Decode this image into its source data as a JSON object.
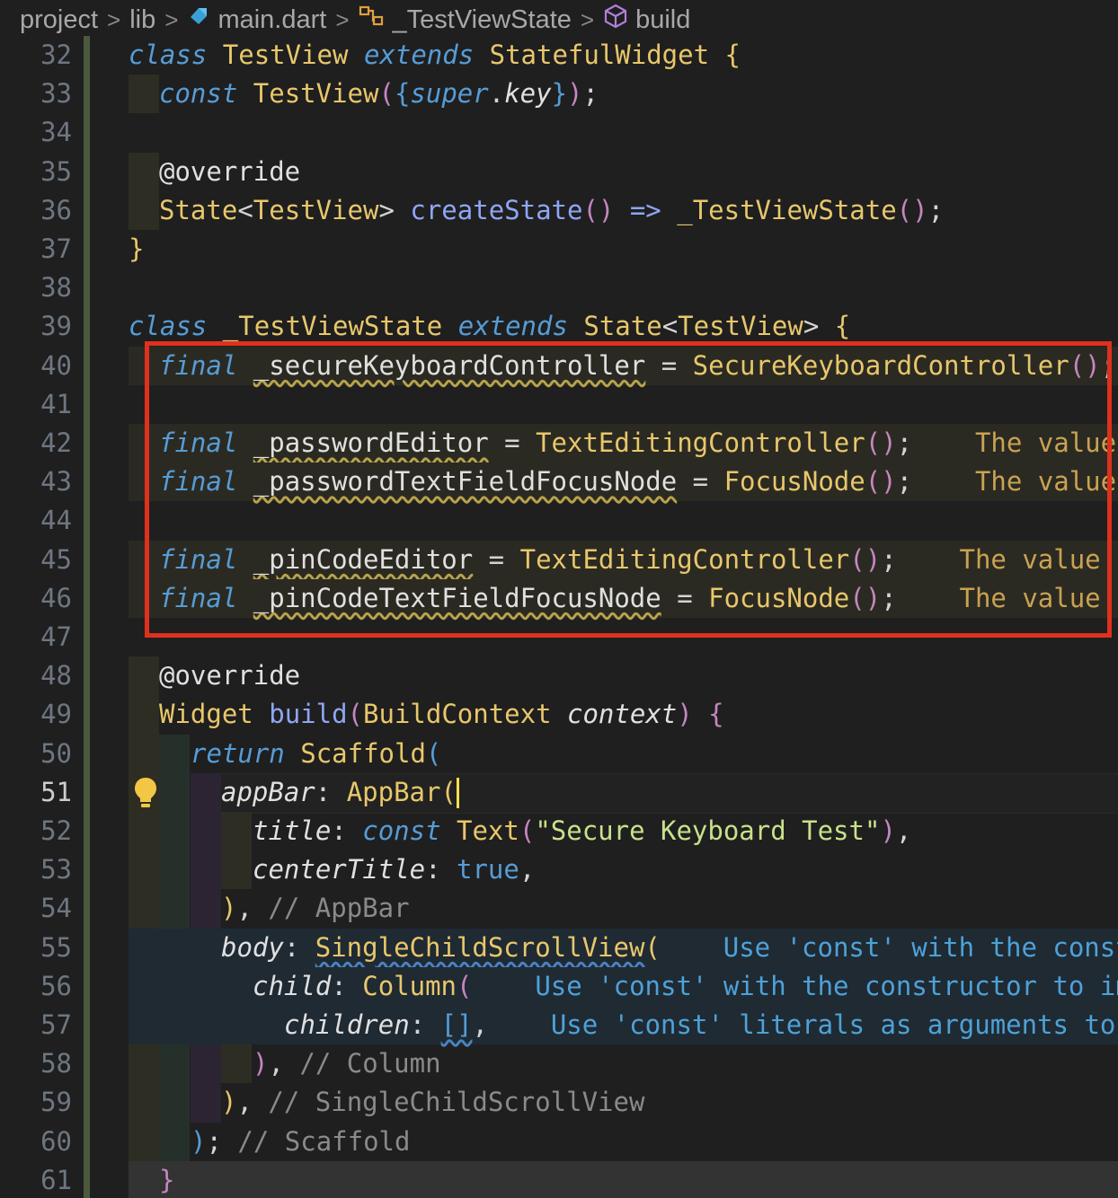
{
  "breadcrumb": {
    "items": [
      "project",
      "lib",
      "main.dart",
      "_TestViewState",
      "build"
    ],
    "separator": ">"
  },
  "editor": {
    "active_line": 51,
    "lines": [
      {
        "n": "32"
      },
      {
        "n": "33"
      },
      {
        "n": "34"
      },
      {
        "n": "35"
      },
      {
        "n": "36"
      },
      {
        "n": "37"
      },
      {
        "n": "38"
      },
      {
        "n": "39"
      },
      {
        "n": "40"
      },
      {
        "n": "41"
      },
      {
        "n": "42"
      },
      {
        "n": "43"
      },
      {
        "n": "44"
      },
      {
        "n": "45"
      },
      {
        "n": "46"
      },
      {
        "n": "47"
      },
      {
        "n": "48"
      },
      {
        "n": "49"
      },
      {
        "n": "50"
      },
      {
        "n": "51"
      },
      {
        "n": "52"
      },
      {
        "n": "53"
      },
      {
        "n": "54"
      },
      {
        "n": "55"
      },
      {
        "n": "56"
      },
      {
        "n": "57"
      },
      {
        "n": "58"
      },
      {
        "n": "59"
      },
      {
        "n": "60"
      },
      {
        "n": "61"
      }
    ],
    "tokens": {
      "class_kw": "class",
      "extends_kw": "extends",
      "const_kw": "const",
      "final_kw": "final",
      "return_kw": "return",
      "override": "@override",
      "testview": "TestView",
      "statefulwidget": "StatefulWidget",
      "super_key": "super",
      "key": "key",
      "state": "State",
      "createstate": "createState",
      "arrow": "=>",
      "testviewstate": "_TestViewState",
      "secure_ctrl_var": "_secureKeyboardController",
      "secure_ctrl_cls": "SecureKeyboardController",
      "password_editor": "_passwordEditor",
      "password_focus": "_passwordTextFieldFocusNode",
      "pincode_editor": "_pinCodeEditor",
      "pincode_focus": "_pinCodeTextFieldFocusNode",
      "tec": "TextEditingController",
      "focusnode": "FocusNode",
      "widget": "Widget",
      "build": "build",
      "buildcontext": "BuildContext",
      "context": "context",
      "scaffold": "Scaffold",
      "appbar_prop": "appBar",
      "appbar": "AppBar",
      "title_prop": "title",
      "text": "Text",
      "title_str": "\"Secure Keyboard Test\"",
      "centertitle": "centerTitle",
      "true_kw": "true",
      "body_prop": "body",
      "scrollview": "SingleChildScrollView",
      "child_prop": "child",
      "column": "Column",
      "children_prop": "children",
      "cm_appbar": "// AppBar",
      "cm_column": "// Column",
      "cm_scrollview": "// SingleChildScrollView",
      "cm_scaffold": "// Scaffold"
    },
    "hints": {
      "value_hint": "The value",
      "value_hint_cut": "The value c",
      "const_hint_55": "Use 'const' with the const",
      "const_hint_56": "Use 'const' with the constructor to im",
      "const_hint_57": "Use 'const' literals as arguments to"
    }
  },
  "colors": {
    "highlight_box": "#e0301e",
    "background": "#1f1f1f"
  }
}
